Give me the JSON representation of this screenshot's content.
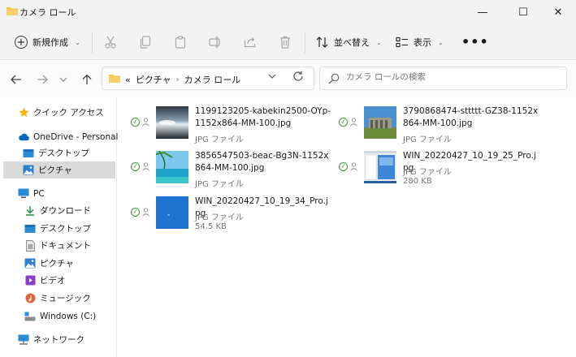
{
  "window": {
    "title": "カメラ ロール",
    "minimize": "—",
    "maximize": "☐",
    "close": "✕"
  },
  "toolbar": {
    "new_label": "新規作成",
    "sort_label": "並べ替え",
    "view_label": "表示",
    "more_label": "•••"
  },
  "address": {
    "overflow": "«",
    "crumbs": [
      "ピクチャ",
      "カメラ ロール"
    ]
  },
  "search": {
    "placeholder": "カメラ ロールの検索"
  },
  "sidebar": {
    "items": [
      {
        "label": "クイック アクセス",
        "icon": "star-icon"
      },
      {
        "label": "OneDrive - Personal",
        "icon": "cloud-icon"
      },
      {
        "label": "デスクトップ",
        "icon": "desktop-icon"
      },
      {
        "label": "ピクチャ",
        "icon": "pictures-icon"
      },
      {
        "label": "PC",
        "icon": "pc-icon"
      },
      {
        "label": "ダウンロード",
        "icon": "download-icon"
      },
      {
        "label": "デスクトップ",
        "icon": "desktop-icon"
      },
      {
        "label": "ドキュメント",
        "icon": "document-icon"
      },
      {
        "label": "ピクチャ",
        "icon": "pictures-icon"
      },
      {
        "label": "ビデオ",
        "icon": "video-icon"
      },
      {
        "label": "ミュージック",
        "icon": "music-icon"
      },
      {
        "label": "Windows (C:)",
        "icon": "drive-icon"
      },
      {
        "label": "ネットワーク",
        "icon": "network-icon"
      }
    ]
  },
  "files": [
    {
      "name": "1199123205-kabekin2500-OYp-1152x864-MM-100.jpg",
      "type": "JPG ファイル",
      "size": ""
    },
    {
      "name": "3790868474-sttttt-GZ38-1152x864-MM-100.jpg",
      "type": "JPG ファイル",
      "size": ""
    },
    {
      "name": "3856547503-beac-Bg3N-1152x864-MM-100.jpg",
      "type": "JPG ファイル",
      "size": ""
    },
    {
      "name": "WIN_20220427_10_19_25_Pro.jpg",
      "type": "JPG ファイル",
      "size": "280 KB"
    },
    {
      "name": "WIN_20220427_10_19_34_Pro.jpg",
      "type": "JPG ファイル",
      "size": "54.5 KB"
    }
  ],
  "colors": {
    "accent": "#0a66c2",
    "folder": "#f5c242",
    "selected": "#dadada",
    "synced": "#3c9a3c"
  }
}
